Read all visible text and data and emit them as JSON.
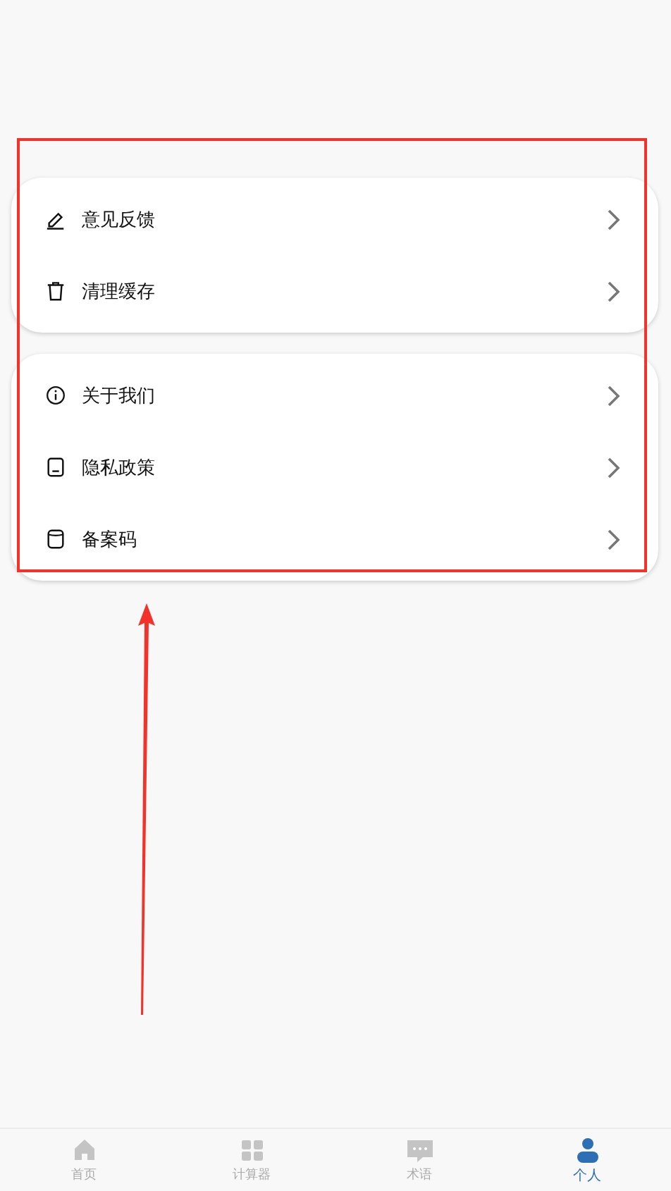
{
  "menu_groups": [
    {
      "items": [
        {
          "label": "意见反馈"
        },
        {
          "label": "清理缓存"
        }
      ]
    },
    {
      "items": [
        {
          "label": "关于我们"
        },
        {
          "label": "隐私政策"
        },
        {
          "label": "备案码"
        }
      ]
    }
  ],
  "bottom_nav": [
    {
      "label": "首页",
      "selected": false
    },
    {
      "label": "计算器",
      "selected": false
    },
    {
      "label": "术语",
      "selected": false
    },
    {
      "label": "个人",
      "selected": true
    }
  ]
}
